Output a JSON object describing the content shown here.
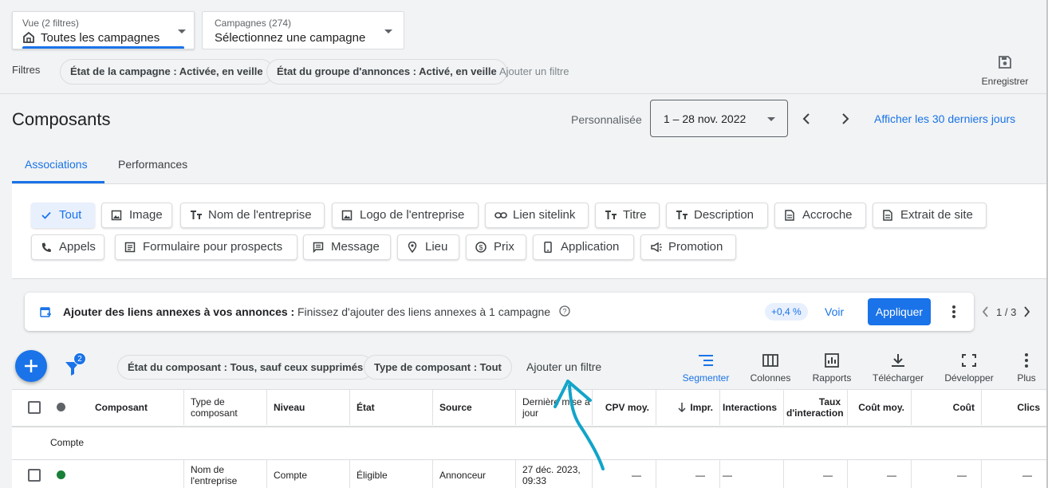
{
  "header": {
    "view_small": "Vue (2 filtres)",
    "view_main": "Toutes les campagnes",
    "campaign_small": "Campagnes (274)",
    "campaign_main": "Sélectionnez une campagne",
    "filters_label": "Filtres",
    "filter_chips": [
      {
        "key": "État de la campagne : ",
        "value": "Activée, en veille"
      },
      {
        "key": "État du groupe d'annonces : ",
        "value": "Activé, en veille"
      }
    ],
    "add_filter": "Ajouter un filtre",
    "save_label": "Enregistrer"
  },
  "page": {
    "title": "Composants",
    "date_label": "Personnalisée",
    "date_range": "1 – 28 nov. 2022",
    "last30": "Afficher les 30 derniers jours"
  },
  "tabs": [
    {
      "label": "Associations",
      "active": true
    },
    {
      "label": "Performances",
      "active": false
    }
  ],
  "asset_chips": [
    {
      "label": "Tout",
      "icon": "check-icon",
      "active": true
    },
    {
      "label": "Image",
      "icon": "image-icon"
    },
    {
      "label": "Nom de l'entreprise",
      "icon": "text-icon"
    },
    {
      "label": "Logo de l'entreprise",
      "icon": "image-icon"
    },
    {
      "label": "Lien sitelink",
      "icon": "link-icon"
    },
    {
      "label": "Titre",
      "icon": "text-icon"
    },
    {
      "label": "Description",
      "icon": "text-icon"
    },
    {
      "label": "Accroche",
      "icon": "document-icon"
    },
    {
      "label": "Extrait de site",
      "icon": "document-icon"
    },
    {
      "label": "Appels",
      "icon": "phone-icon"
    },
    {
      "label": "Formulaire pour prospects",
      "icon": "form-icon"
    },
    {
      "label": "Message",
      "icon": "message-icon"
    },
    {
      "label": "Lieu",
      "icon": "location-icon"
    },
    {
      "label": "Prix",
      "icon": "price-icon"
    },
    {
      "label": "Application",
      "icon": "mobile-icon"
    },
    {
      "label": "Promotion",
      "icon": "megaphone-icon"
    }
  ],
  "banner": {
    "title": "Ajouter des liens annexes à vos annonces : ",
    "text": "Finissez d'ajouter des liens annexes à 1 campagne",
    "badge": "+0,4 %",
    "view": "Voir",
    "apply": "Appliquer",
    "pager": "1 / 3"
  },
  "table_toolbar": {
    "filter_count": "2",
    "filter_chips": [
      {
        "key": "État du composant : ",
        "value": "Tous, sauf ceux supprimés"
      },
      {
        "key": "Type de composant : ",
        "value": "Tout"
      }
    ],
    "add_filter": "Ajouter un filtre",
    "buttons": [
      "Segmenter",
      "Colonnes",
      "Rapports",
      "Télécharger",
      "Développer",
      "Plus"
    ]
  },
  "table": {
    "headers": [
      "Composant",
      "Type de composant",
      "Niveau",
      "État",
      "Source",
      "Dernière mise à jour",
      "CPV moy.",
      "Impr.",
      "Interactions",
      "Taux d'interaction",
      "Coût moy.",
      "Coût",
      "Clics"
    ],
    "group_label": "Compte",
    "rows": [
      {
        "asset": "",
        "type": "Nom de l'entreprise",
        "level": "Compte",
        "state": "Éligible",
        "source": "Annonceur",
        "updated": "27 déc. 2023, 09:33",
        "cpv": "—",
        "impr": "—",
        "interactions": "—",
        "rate": "—",
        "avg_cost": "—",
        "cost": "—",
        "clicks": "—"
      }
    ]
  },
  "colors": {
    "accent": "#1a73e8",
    "status_green": "#188038",
    "annotation_arrow": "#12a4c9"
  }
}
